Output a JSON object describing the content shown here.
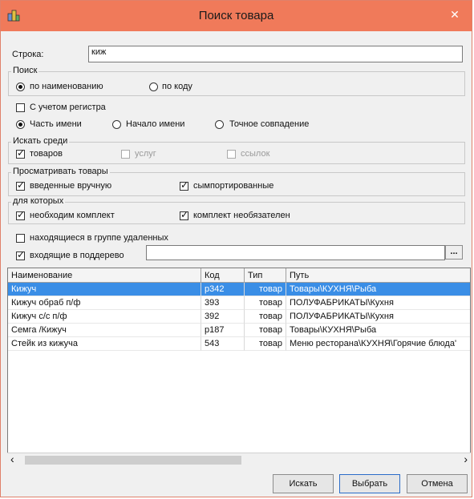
{
  "window": {
    "title": "Поиск товара",
    "close_glyph": "✕"
  },
  "search": {
    "label": "Строка:",
    "value": "киж"
  },
  "search_mode": {
    "legend": "Поиск",
    "by_name": "по наименованию",
    "by_code": "по коду",
    "selected": "by_name"
  },
  "case_sensitive": {
    "label": "С учетом регистра",
    "checked": false
  },
  "match_mode": {
    "part": "Часть имени",
    "start": "Начало имени",
    "exact": "Точное совпадение",
    "selected": "part"
  },
  "search_among": {
    "legend": "Искать среди",
    "goods": "товаров",
    "services": "услуг",
    "links": "ссылок"
  },
  "view_goods": {
    "legend": "Просматривать товары",
    "manual": "введенные вручную",
    "imported": "сымпортированные"
  },
  "for_which": {
    "legend": "для которых",
    "kit_required": "необходим комплект",
    "kit_optional": "комплект необязателен"
  },
  "in_deleted_group": {
    "label": "находящиеся в группе удаленных",
    "checked": false
  },
  "in_subtree": {
    "label": "входящие в поддерево",
    "checked": true,
    "value": "",
    "browse": "..."
  },
  "table": {
    "headers": [
      "Наименование",
      "Код",
      "Тип",
      "Путь"
    ],
    "rows": [
      {
        "name": "Кижуч",
        "code": "р342",
        "type": "товар",
        "path": "Товары\\КУХНЯ\\Рыба",
        "selected": true
      },
      {
        "name": "Кижуч обраб п/ф",
        "code": "393",
        "type": "товар",
        "path": "ПОЛУФАБРИКАТЫ\\Кухня"
      },
      {
        "name": "Кижуч с/с п/ф",
        "code": "392",
        "type": "товар",
        "path": "ПОЛУФАБРИКАТЫ\\Кухня"
      },
      {
        "name": "Семга /Кижуч",
        "code": "р187",
        "type": "товар",
        "path": "Товары\\КУХНЯ\\Рыба"
      },
      {
        "name": "Стейк из кижуча",
        "code": "543",
        "type": "товар",
        "path": "Меню ресторана\\КУХНЯ\\Горячие блюда'"
      }
    ]
  },
  "buttons": {
    "search": "Искать",
    "select": "Выбрать",
    "cancel": "Отмена"
  },
  "scroll": {
    "left": "‹",
    "right": "›"
  },
  "colors": {
    "titlebar": "#f07a5a",
    "selection": "#3a8ee6"
  }
}
